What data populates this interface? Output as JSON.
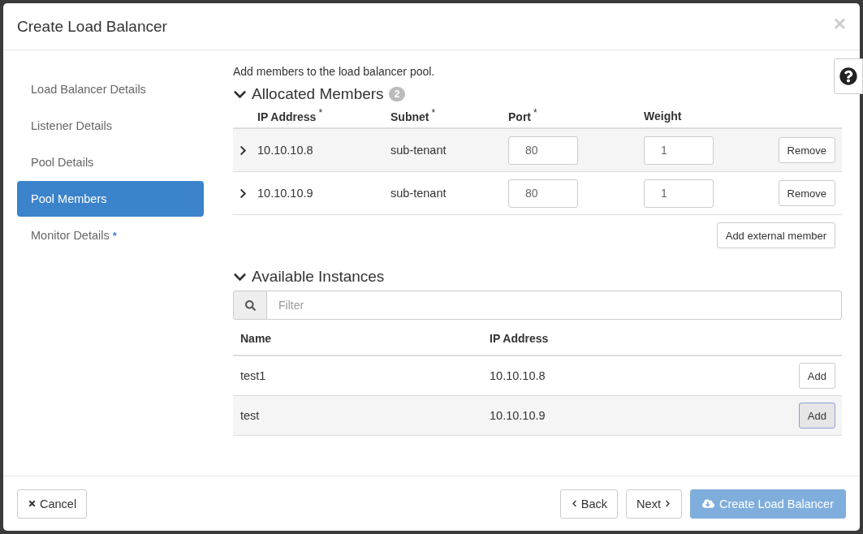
{
  "dialog": {
    "title": "Create Load Balancer",
    "close": "×"
  },
  "required_marker": "*",
  "steps": [
    {
      "label": "Load Balancer Details",
      "selected": false,
      "required": false
    },
    {
      "label": "Listener Details",
      "selected": false,
      "required": false
    },
    {
      "label": "Pool Details",
      "selected": false,
      "required": false
    },
    {
      "label": "Pool Members",
      "selected": true,
      "required": false
    },
    {
      "label": "Monitor Details",
      "selected": false,
      "required": true
    }
  ],
  "intro": "Add members to the load balancer pool.",
  "allocated": {
    "title": "Allocated Members",
    "expanded": true,
    "count": "2",
    "columns": [
      {
        "label": "IP Address",
        "required": true
      },
      {
        "label": "Subnet",
        "required": true
      },
      {
        "label": "Port",
        "required": true
      },
      {
        "label": "Weight",
        "required": false
      }
    ],
    "rows": [
      {
        "ip": "10.10.10.8",
        "subnet": "sub-tenant",
        "port": "80",
        "weight": "1",
        "action": "Remove",
        "expanded": false
      },
      {
        "ip": "10.10.10.9",
        "subnet": "sub-tenant",
        "port": "80",
        "weight": "1",
        "action": "Remove",
        "expanded": false
      }
    ],
    "add_button": "Add external member"
  },
  "available": {
    "title": "Available Instances",
    "expanded": true,
    "filter_placeholder": "Filter",
    "columns": [
      "Name",
      "IP Address"
    ],
    "rows": [
      {
        "name": "test1",
        "ip": "10.10.10.8",
        "action": "Add",
        "focused": false
      },
      {
        "name": "test",
        "ip": "10.10.10.9",
        "action": "Add",
        "focused": true
      }
    ]
  },
  "footer": {
    "cancel": "Cancel",
    "back": "Back",
    "next": "Next",
    "create": "Create Load Balancer",
    "create_disabled": true
  }
}
